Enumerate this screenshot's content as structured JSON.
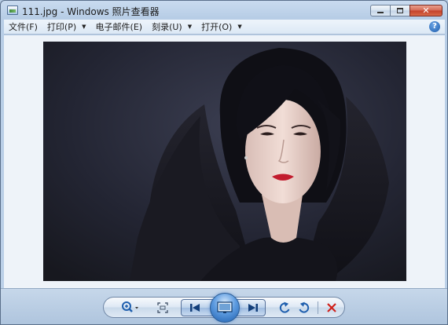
{
  "window": {
    "title": "111.jpg - Windows 照片查看器",
    "minimize_glyph": "▭",
    "maximize_glyph": "□",
    "close_glyph": "✕"
  },
  "menu": {
    "items": [
      {
        "label": "文件(F)"
      },
      {
        "label": "打印(P)"
      },
      {
        "label": "电子邮件(E)"
      },
      {
        "label": "刻录(U)"
      },
      {
        "label": "打开(O)"
      }
    ],
    "help_glyph": "?"
  },
  "photo": {
    "icon": "portrait-photo",
    "colors": {
      "background": "#22232f",
      "hair": "#0f0f14",
      "skin": "#ecd6d0",
      "coat": "#15151c",
      "lips": "#c21c2e"
    }
  },
  "toolbar": {
    "zoom_icon": "zoom-icon",
    "fit_icon": "actual-size-icon",
    "prev_icon": "previous-icon",
    "slideshow_icon": "slideshow-icon",
    "next_icon": "next-icon",
    "rotate_left_icon": "rotate-counterclockwise-icon",
    "rotate_right_icon": "rotate-clockwise-icon",
    "delete_icon": "delete-icon",
    "accent": "#1f5fae",
    "delete_color": "#d0201a"
  }
}
